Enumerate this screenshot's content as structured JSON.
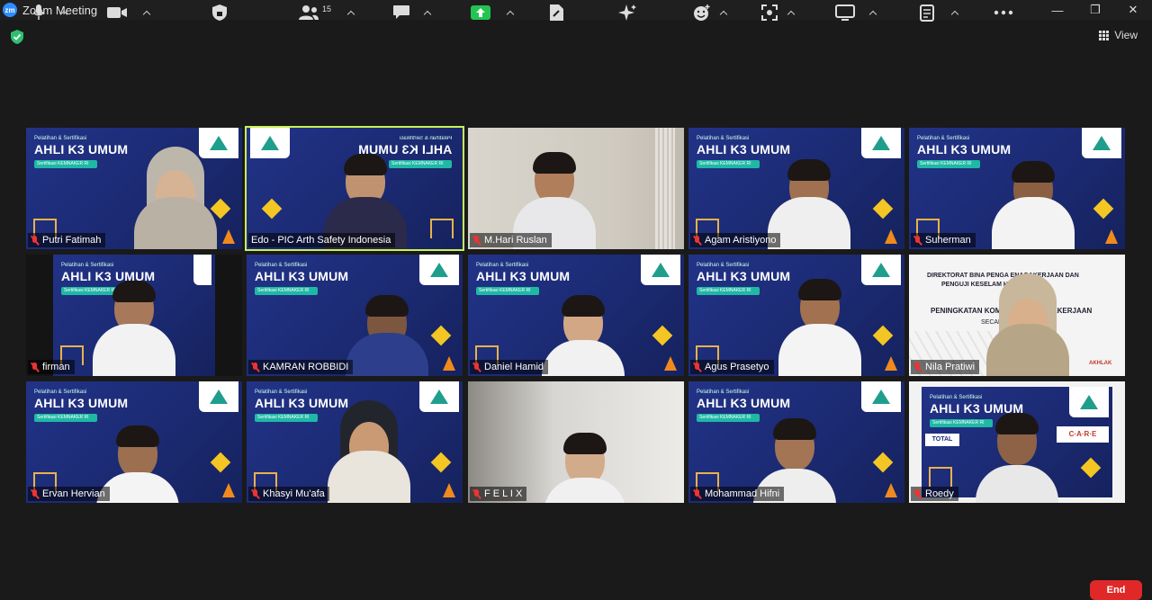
{
  "window": {
    "app_badge": "zm",
    "title": "Zoom Meeting",
    "controls": {
      "minimize": "—",
      "restore": "❐",
      "close": "✕"
    }
  },
  "header": {
    "view_label": "View",
    "security_badge_color": "#2fbf71"
  },
  "banner_text": {
    "small": "Pelatihan & Sertifikasi",
    "title": "AHLI K3 UMUM",
    "pill": "Sertifikasi KEMNAKER RI"
  },
  "slide_text": {
    "line1": "DIREKTORAT BINA PENGA   ENAGAKERJAAN DAN",
    "line1b": "PENGUJI KESELAM   HATAN KERJA",
    "line2": "PENINGKATAN KOMPETE       ETENAGAKERJAAN",
    "line3": "SECARA",
    "care": "C·A·R·E",
    "total": "TOTAL",
    "akhlak": "AKHLAK"
  },
  "participants": [
    {
      "name": "Putri Fatimah"
    },
    {
      "name": "Edo - PIC Arth Safety Indonesia"
    },
    {
      "name": "M.Hari Ruslan"
    },
    {
      "name": "Agam Aristiyono"
    },
    {
      "name": "Suherman"
    },
    {
      "name": "firman"
    },
    {
      "name": "KAMRAN ROBBIDI"
    },
    {
      "name": "Daniel Hamid"
    },
    {
      "name": "Agus Prasetyo"
    },
    {
      "name": "Nila Pratiwi"
    },
    {
      "name": "Ervan Hervian"
    },
    {
      "name": "Khasyi Mu'afa"
    },
    {
      "name": "F E L I X"
    },
    {
      "name": "Mohammad Hifni"
    },
    {
      "name": "Roedy"
    }
  ],
  "toolbar": {
    "participants_count": "15",
    "end_label": "End",
    "share_color": "#23c552",
    "end_color": "#e02828"
  }
}
